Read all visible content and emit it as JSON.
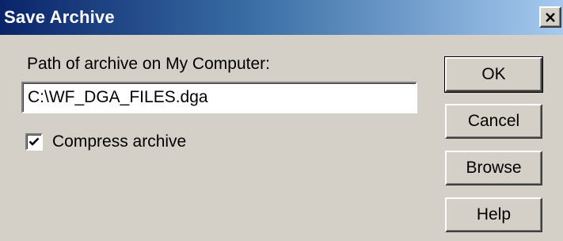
{
  "window": {
    "title": "Save Archive"
  },
  "form": {
    "path_label": "Path of archive on My Computer:",
    "path_value": "C:\\WF_DGA_FILES.dga",
    "compress_label": "Compress archive",
    "compress_checked": true
  },
  "buttons": {
    "ok": "OK",
    "cancel": "Cancel",
    "browse": "Browse",
    "help": "Help"
  },
  "icons": {
    "close": "close-icon",
    "check": "checkmark-icon"
  },
  "colors": {
    "title_gradient_start": "#0a246a",
    "title_gradient_end": "#a6caf0",
    "face": "#d4d0c8"
  }
}
